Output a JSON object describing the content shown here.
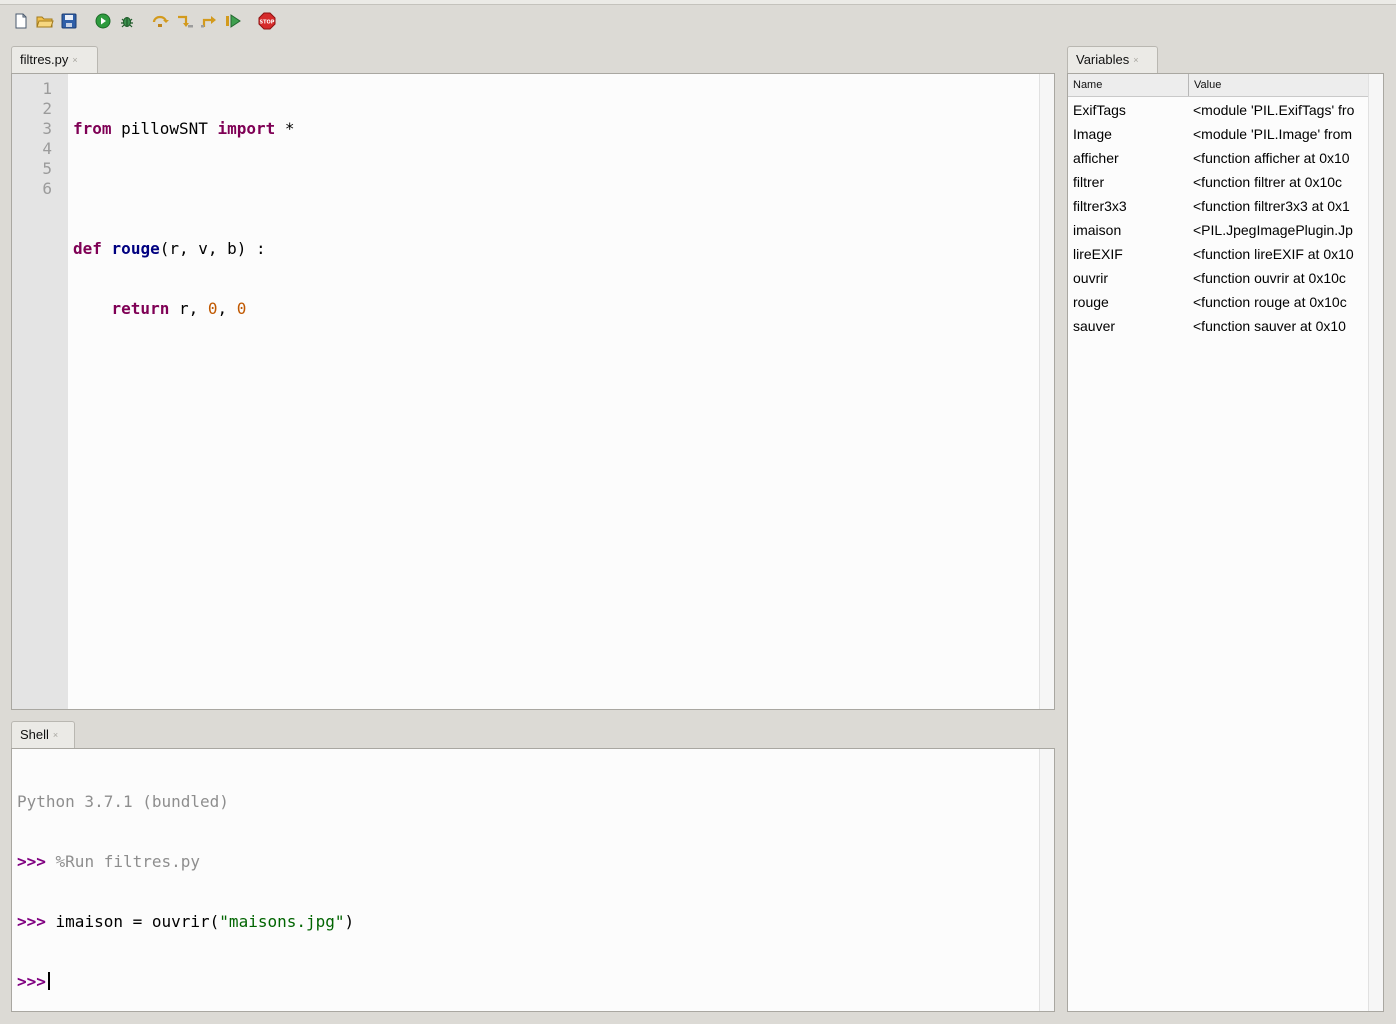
{
  "toolbar": {
    "buttons": [
      "new-file",
      "open-file",
      "save-file",
      "run",
      "debug",
      "step-over",
      "step-into",
      "step-out",
      "resume",
      "stop"
    ],
    "stop_label": "STOP"
  },
  "editor": {
    "tab_label": "filtres.py",
    "close_glyph": "×",
    "line_numbers": [
      "1",
      "2",
      "3",
      "4",
      "5",
      "6"
    ],
    "line1": {
      "kw1": "from",
      "mod": " pillowSNT ",
      "kw2": "import",
      "rest": " *"
    },
    "line3": {
      "kw": "def",
      "sp": " ",
      "fn": "rouge",
      "rest": "(r, v, b) :"
    },
    "line4": {
      "indent": "    ",
      "kw": "return",
      "a": " r, ",
      "n1": "0",
      "sep": ", ",
      "n2": "0"
    }
  },
  "shell": {
    "tab_label": "Shell",
    "close_glyph": "×",
    "banner": "Python 3.7.1 (bundled)",
    "prompt": ">>>",
    "cmd1": " %Run filtres.py",
    "cmd2_a": " imaison = ouvrir(",
    "cmd2_str": "\"maisons.jpg\"",
    "cmd2_b": ")"
  },
  "variables": {
    "tab_label": "Variables",
    "close_glyph": "×",
    "col_name": "Name",
    "col_value": "Value",
    "rows": [
      {
        "name": "ExifTags",
        "value": "<module 'PIL.ExifTags' fro"
      },
      {
        "name": "Image",
        "value": "<module 'PIL.Image' from"
      },
      {
        "name": "afficher",
        "value": "<function afficher at 0x10"
      },
      {
        "name": "filtrer",
        "value": "<function filtrer at 0x10c"
      },
      {
        "name": "filtrer3x3",
        "value": "<function filtrer3x3 at 0x1"
      },
      {
        "name": "imaison",
        "value": "<PIL.JpegImagePlugin.Jp"
      },
      {
        "name": "lireEXIF",
        "value": "<function lireEXIF at 0x10"
      },
      {
        "name": "ouvrir",
        "value": "<function ouvrir at 0x10c"
      },
      {
        "name": "rouge",
        "value": "<function rouge at 0x10c"
      },
      {
        "name": "sauver",
        "value": "<function sauver at 0x10"
      }
    ]
  }
}
